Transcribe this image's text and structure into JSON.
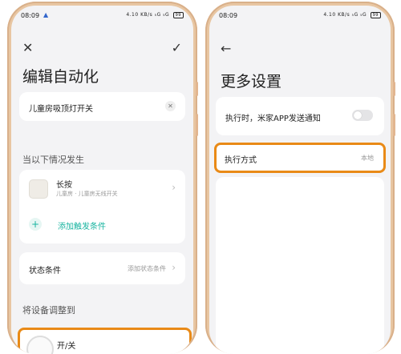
{
  "left": {
    "status": {
      "time": "08:09",
      "network": "▲",
      "right_info": "4.10 KB/s  ₅G  ₅G",
      "battery": "99"
    },
    "title": "编辑自动化",
    "name_value": "儿童房吸顶灯开关",
    "section_when": "当以下情况发生",
    "trigger": {
      "title": "长按",
      "subtitle": "儿童房 · 儿童房无线开关"
    },
    "add_trigger_label": "添加触发条件",
    "condition": {
      "label": "状态条件",
      "value": "添加状态条件"
    },
    "section_adjust": "将设备调整到",
    "device_action_label": "开/关"
  },
  "right": {
    "status": {
      "time": "08:09",
      "right_info": "4.10 KB/s  ₅G  ₅G",
      "battery": "99"
    },
    "title": "更多设置",
    "notify_label": "执行时，米家APP发送通知",
    "notify_on": false,
    "exec_label": "执行方式",
    "exec_value": "本地"
  },
  "colors": {
    "highlight": "#e98a17",
    "accent": "#19b4a0",
    "phone_frame": "#e8c6a2"
  }
}
